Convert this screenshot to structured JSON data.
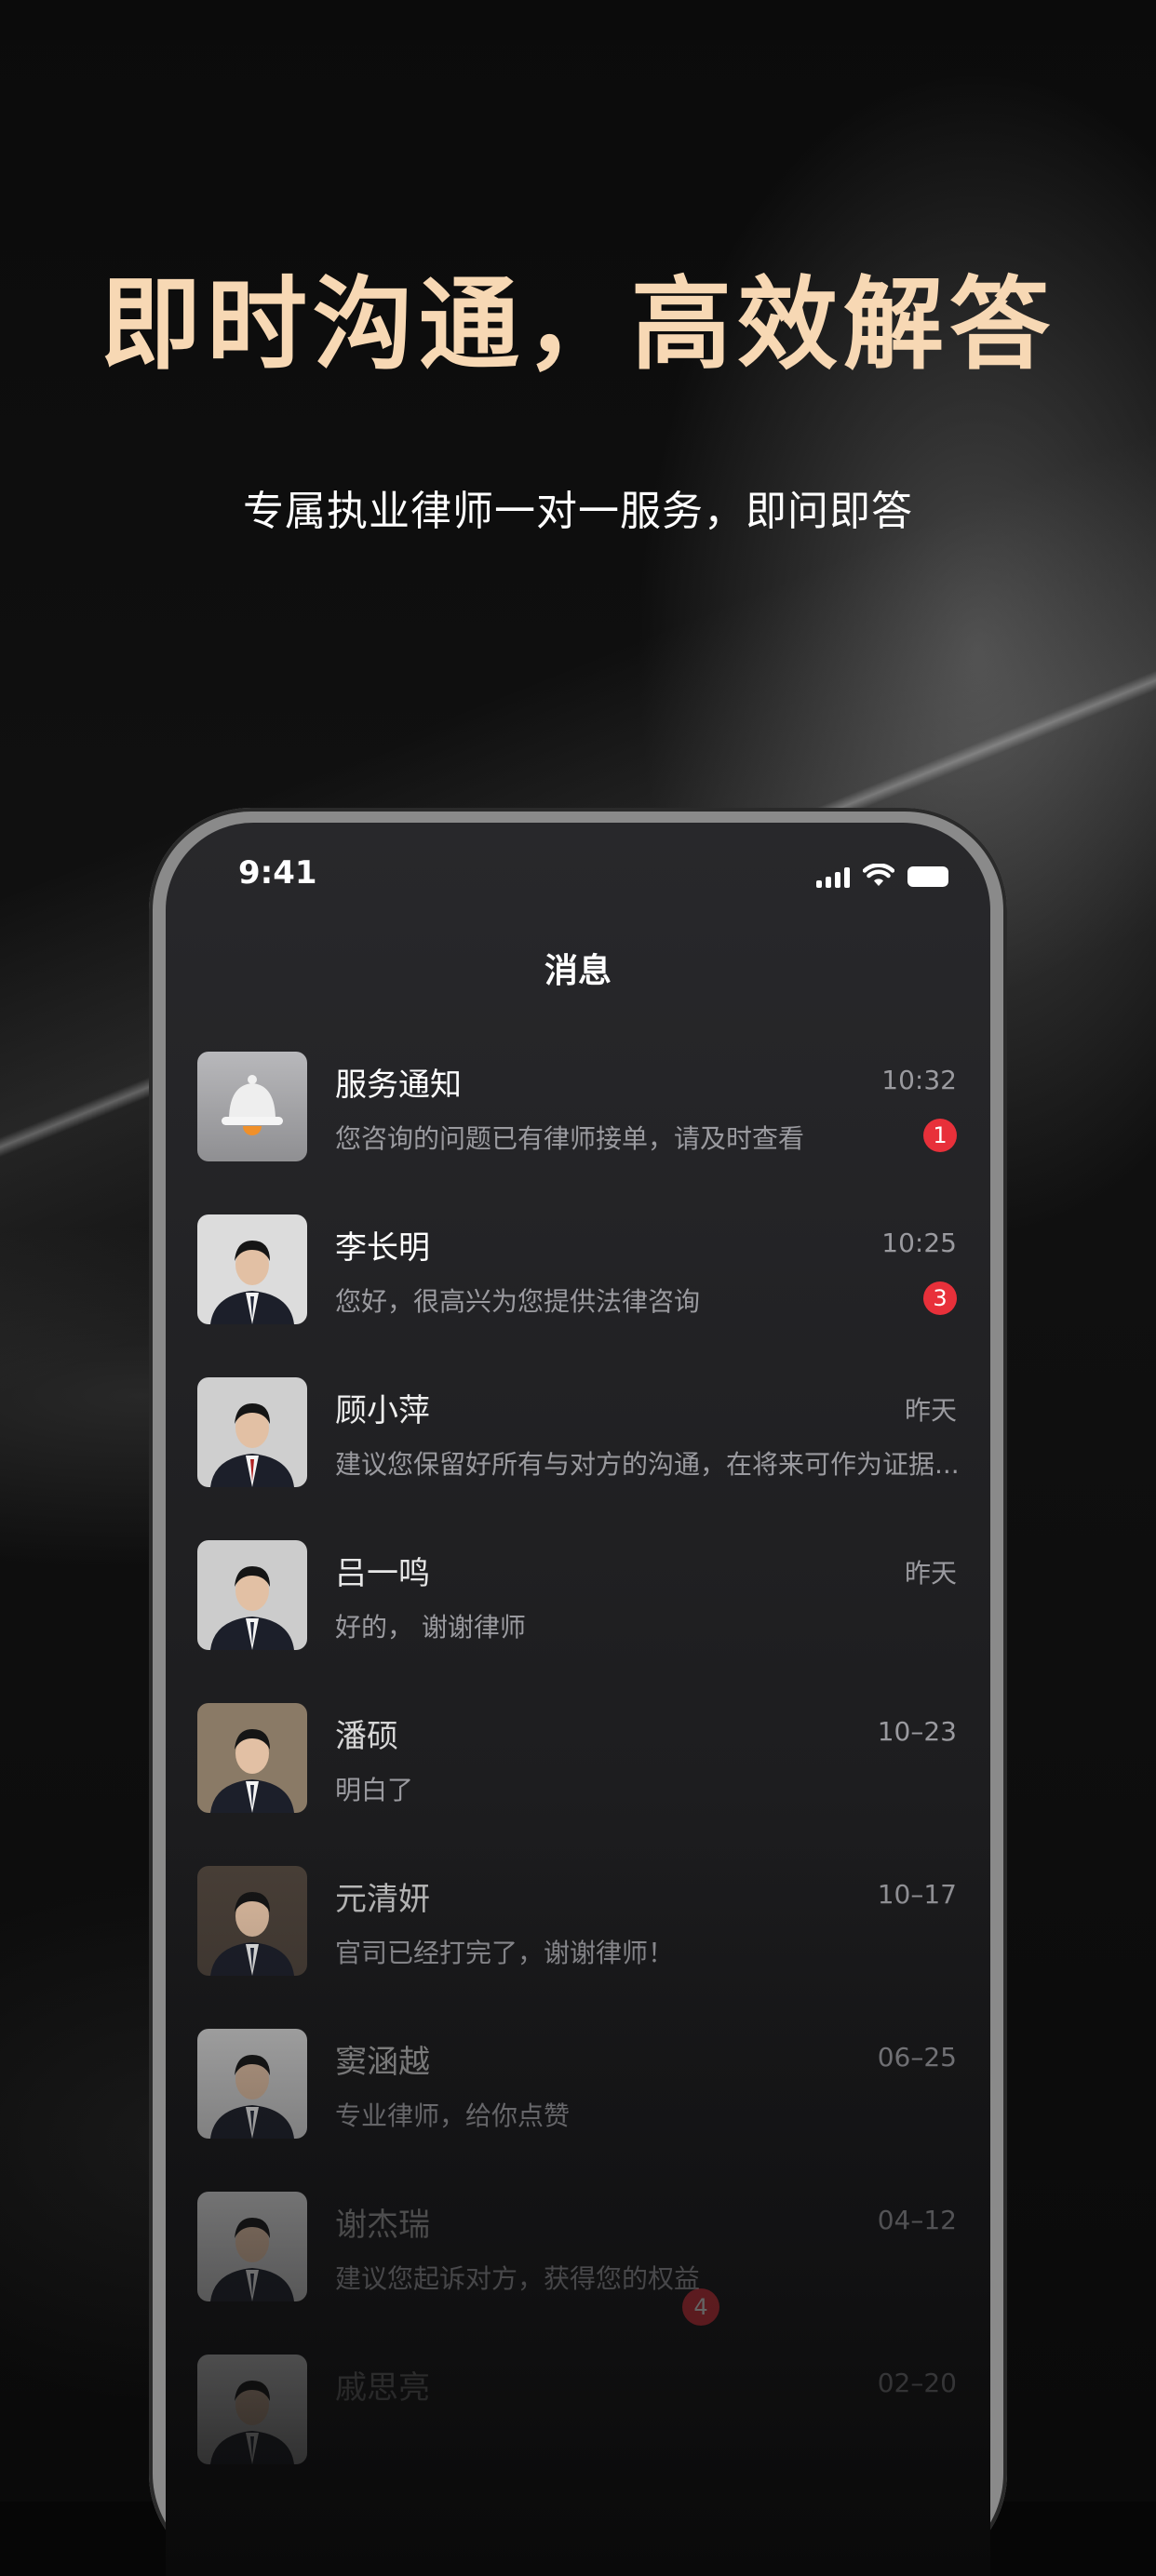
{
  "promo": {
    "headline": "即时沟通，高效解答",
    "subline": "专属执业律师一对一服务，即问即答"
  },
  "status_bar": {
    "time": "9:41"
  },
  "screen": {
    "title": "消息"
  },
  "conversations": [
    {
      "name": "服务通知",
      "time": "10:32",
      "preview": "您咨询的问题已有律师接单，请及时查看",
      "unread": "1",
      "avatar": "bell-icon"
    },
    {
      "name": "李长明",
      "time": "10:25",
      "preview": "您好，很高兴为您提供法律咨询",
      "unread": "3",
      "avatar": "lawyer-photo"
    },
    {
      "name": "顾小萍",
      "time": "昨天",
      "preview": "建议您保留好所有与对方的沟通，在将来可作为证据...",
      "unread": "",
      "avatar": "lawyer-photo"
    },
    {
      "name": "吕一鸣",
      "time": "昨天",
      "preview": "好的， 谢谢律师",
      "unread": "",
      "avatar": "lawyer-photo"
    },
    {
      "name": "潘硕",
      "time": "10–23",
      "preview": "明白了",
      "unread": "",
      "avatar": "lawyer-photo"
    },
    {
      "name": "元清妍",
      "time": "10–17",
      "preview": "官司已经打完了，谢谢律师！",
      "unread": "",
      "avatar": "lawyer-photo"
    },
    {
      "name": "窦涵越",
      "time": "06–25",
      "preview": "专业律师，给你点赞",
      "unread": "",
      "avatar": "lawyer-photo"
    },
    {
      "name": "谢杰瑞",
      "time": "04–12",
      "preview": "建议您起诉对方，获得您的权益",
      "unread": "",
      "avatar": "lawyer-photo"
    },
    {
      "name": "戚思亮",
      "time": "02–20",
      "preview": "",
      "unread": "",
      "avatar": "lawyer-photo"
    }
  ],
  "tab_bar": {
    "unread": "4"
  },
  "colors": {
    "headline": "#f7d8b4",
    "badge": "#e8303a",
    "screen_bg": "#28282b"
  }
}
